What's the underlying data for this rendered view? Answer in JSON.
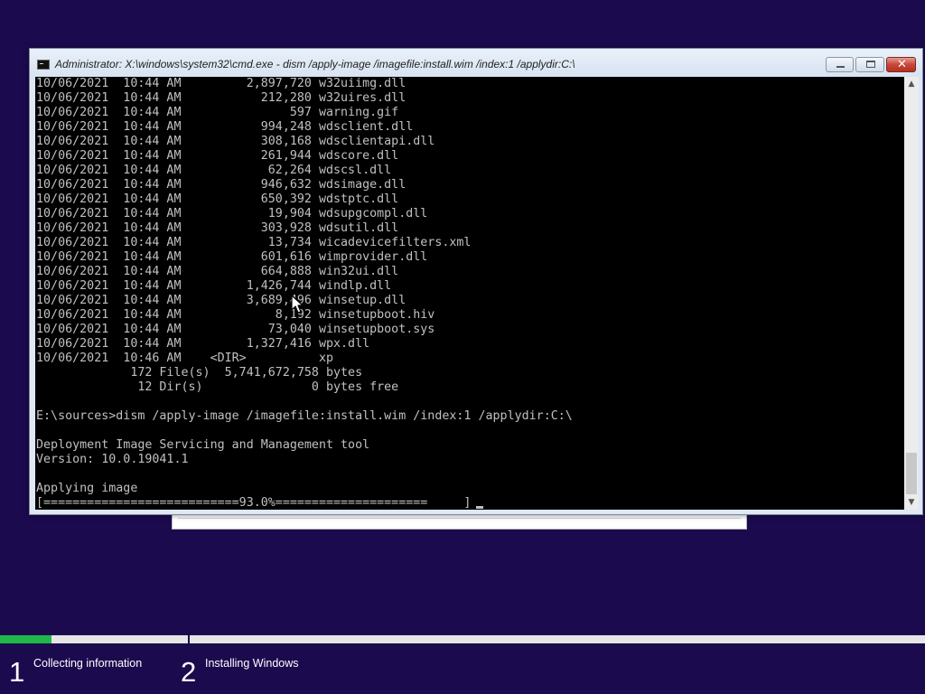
{
  "setup_dialog": {},
  "console_window": {
    "title": "Administrator: X:\\windows\\system32\\cmd.exe - dism  /apply-image /imagefile:install.wim /index:1 /applydir:C:\\",
    "minimize_glyph": "",
    "maximize_glyph": "",
    "close_glyph": "✕",
    "output": "10/06/2021  10:44 AM         2,897,720 w32uiimg.dll\n10/06/2021  10:44 AM           212,280 w32uires.dll\n10/06/2021  10:44 AM               597 warning.gif\n10/06/2021  10:44 AM           994,248 wdsclient.dll\n10/06/2021  10:44 AM           308,168 wdsclientapi.dll\n10/06/2021  10:44 AM           261,944 wdscore.dll\n10/06/2021  10:44 AM            62,264 wdscsl.dll\n10/06/2021  10:44 AM           946,632 wdsimage.dll\n10/06/2021  10:44 AM           650,392 wdstptc.dll\n10/06/2021  10:44 AM            19,904 wdsupgcompl.dll\n10/06/2021  10:44 AM           303,928 wdsutil.dll\n10/06/2021  10:44 AM            13,734 wicadevicefilters.xml\n10/06/2021  10:44 AM           601,616 wimprovider.dll\n10/06/2021  10:44 AM           664,888 win32ui.dll\n10/06/2021  10:44 AM         1,426,744 windlp.dll\n10/06/2021  10:44 AM         3,689,496 winsetup.dll\n10/06/2021  10:44 AM             8,192 winsetupboot.hiv\n10/06/2021  10:44 AM            73,040 winsetupboot.sys\n10/06/2021  10:44 AM         1,327,416 wpx.dll\n10/06/2021  10:46 AM    <DIR>          xp\n             172 File(s)  5,741,672,758 bytes\n              12 Dir(s)               0 bytes free\n\nE:\\sources>dism /apply-image /imagefile:install.wim /index:1 /applydir:C:\\\n\nDeployment Image Servicing and Management tool\nVersion: 10.0.19041.1\n\nApplying image\n[===========================93.0%=====================     ]",
    "scroll_up_glyph": "▲",
    "scroll_down_glyph": "▼"
  },
  "progress": {
    "overall_fraction": 0.056,
    "accent_color": "#21b84a"
  },
  "steps": [
    {
      "number": "1",
      "label": "Collecting information"
    },
    {
      "number": "2",
      "label": "Installing Windows"
    }
  ],
  "colors": {
    "background": "#1c0a4e",
    "console_text": "#c0c0c0"
  },
  "icons": {
    "title_icon": "cmd-icon",
    "pointer": "mouse-pointer-icon"
  }
}
